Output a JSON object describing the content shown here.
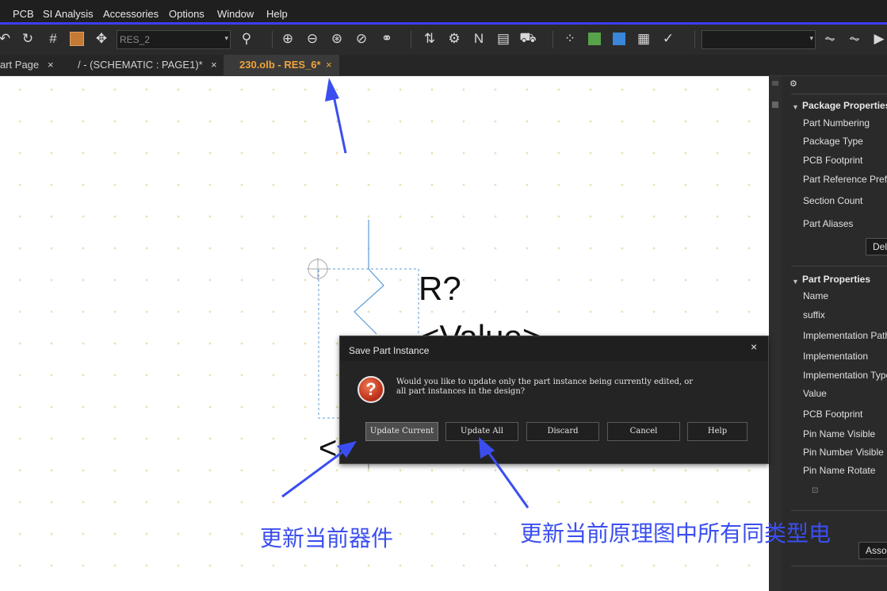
{
  "menu": [
    "PCB",
    "SI Analysis",
    "Accessories",
    "Options",
    "Window",
    "Help"
  ],
  "toolbar": {
    "part_combo_value": "RES_2",
    "icons": [
      "redo-icon",
      "grid-icon",
      "area-select-icon",
      "snap-icon",
      "zoom-icon",
      "zoom-in-icon",
      "zoom-out-icon",
      "zoom-area-icon",
      "zoom-all-icon",
      "link-icon",
      "edit-properties-icon",
      "netlist-icon",
      "drc-icon",
      "cart-icon",
      "pin-array-icon",
      "package-icon",
      "sync-icon",
      "report-icon",
      "check-icon",
      "probe-icon",
      "run-icon"
    ]
  },
  "tabs": [
    {
      "label": "art Page",
      "close": "×"
    },
    {
      "label": "/ - (SCHEMATIC : PAGE1)*",
      "close": "×"
    },
    {
      "label": "230.olb - RES_6*",
      "close": "×",
      "active": true
    }
  ],
  "schematic": {
    "ref_label": "R?",
    "value_label": "<Value>",
    "partial_left_label": "<"
  },
  "dialog": {
    "title": "Save Part Instance",
    "close": "×",
    "icon": "?",
    "message": "Would you like to update only the part instance being currently edited, or all part instances in the design?",
    "buttons": [
      "Update Current",
      "Update All",
      "Discard",
      "Cancel",
      "Help"
    ]
  },
  "panel": {
    "package_header": "Package Properties",
    "package_items": [
      "Part Numbering",
      "Package Type",
      "PCB Footprint",
      "Part Reference Prefix",
      "Section Count",
      "Part Aliases"
    ],
    "delete_button": "Del",
    "part_header": "Part Properties",
    "part_items": [
      "Name",
      "suffix",
      "Implementation Path",
      "Implementation",
      "Implementation Type",
      "Value",
      "PCB Footprint",
      "Pin Name Visible",
      "Pin Number Visible",
      "Pin Name Rotate"
    ],
    "associate_button": "Assoc"
  },
  "annotations": {
    "left_note": "更新当前器件",
    "right_note": "更新当前原理图中所有同类型电",
    "arrow_color": "#3a4ef0"
  }
}
